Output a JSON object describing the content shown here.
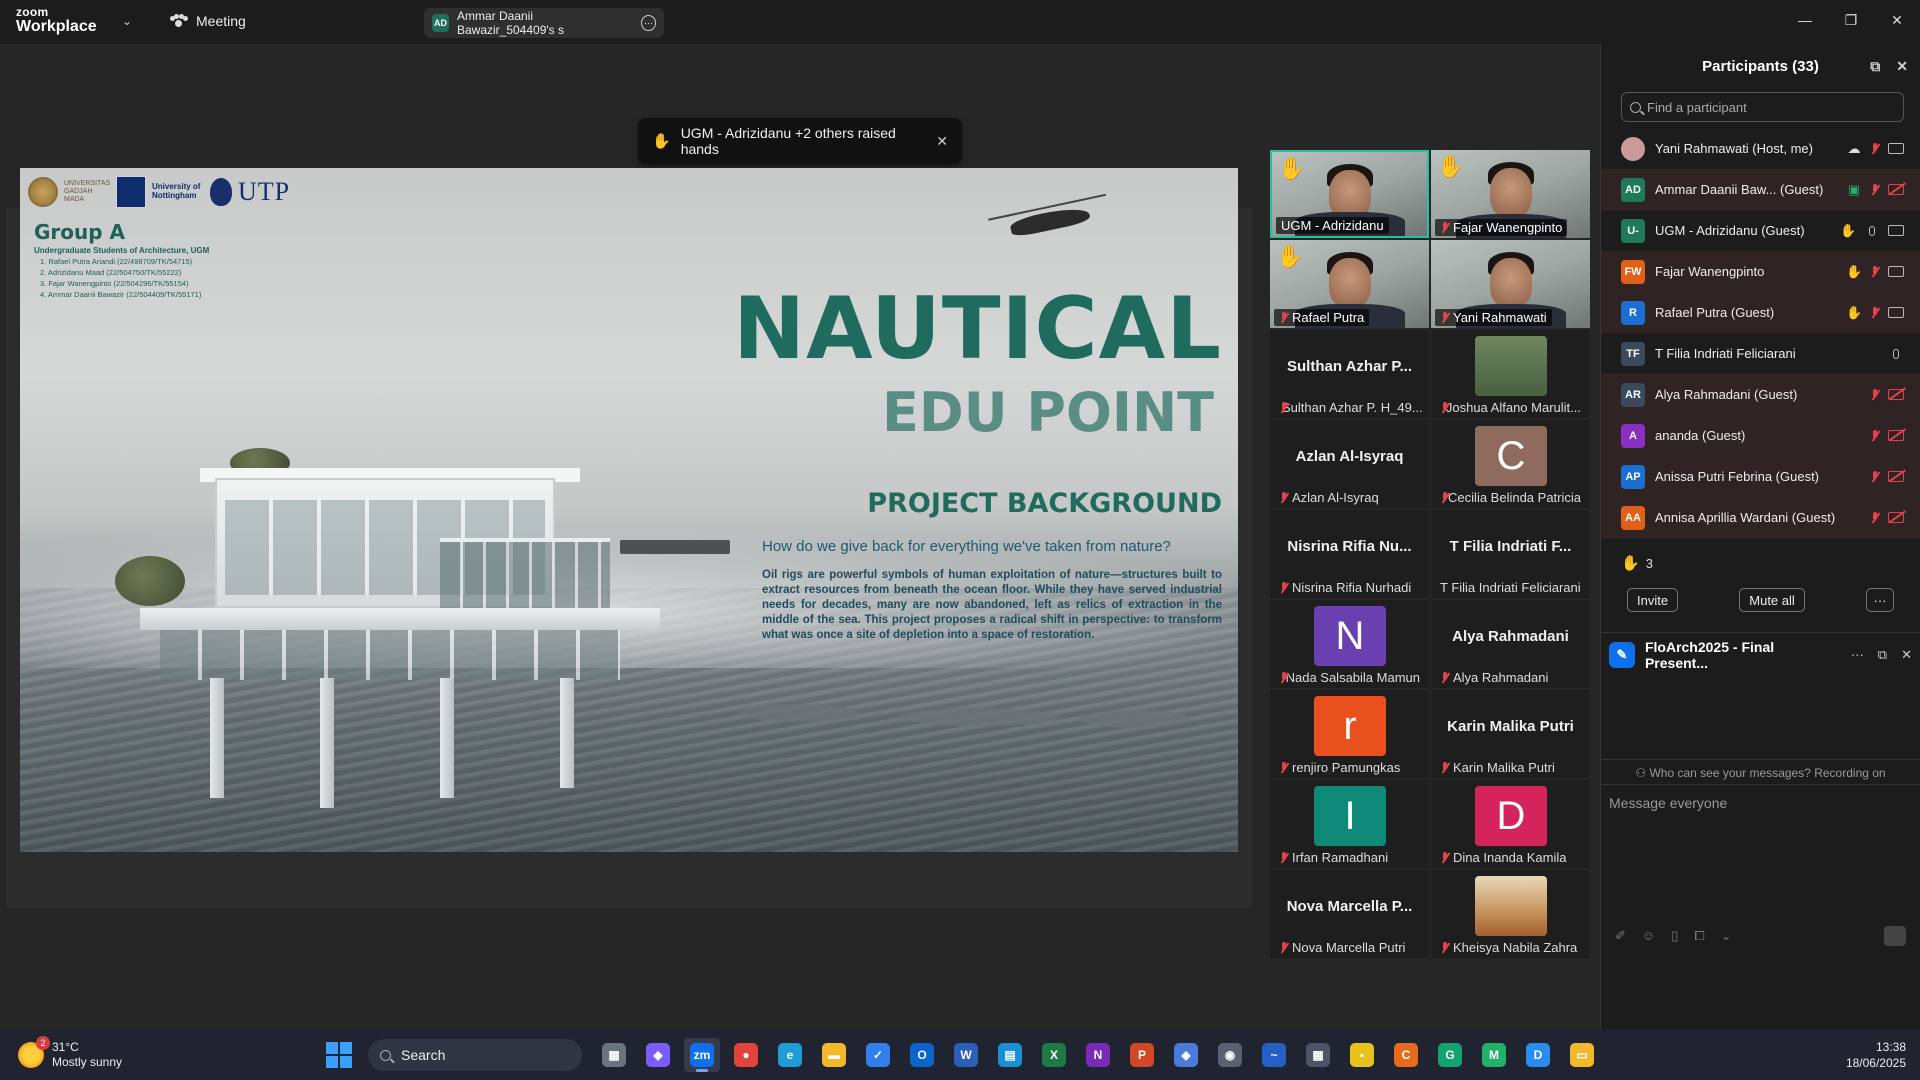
{
  "app": {
    "brand_top": "zoom",
    "brand_bottom": "Workplace",
    "meeting_menu": "Meeting",
    "share_tab": {
      "initials": "AD",
      "label": "Ammar Daanii Bawazir_504409's s"
    }
  },
  "raise_banner": {
    "text": "UGM - Adrizidanu +2 others raised hands"
  },
  "slide": {
    "logos": {
      "ugm": "UNIVERSITAS GADJAH MADA",
      "nottingham": "University of Nottingham",
      "utp": "UTP"
    },
    "group_title": "Group A",
    "group_sub": "Undergraduate Students of Architecture, UGM",
    "members": [
      "1. Rafael Putra Ariandi (22/498709/TK/54715)",
      "2. Adrizidanu Maad (22/504750/TK/55222)",
      "3. Fajar Wanengpinto (22/504296/TK/55154)",
      "4. Ammar Daanii Bawazir (22/504409/TK/55171)"
    ],
    "title": "NAUTICAL",
    "subtitle": "EDU POINT",
    "section": "PROJECT BACKGROUND",
    "question": "How do we give back for everything we've taken from nature?",
    "body": "Oil rigs are powerful symbols of human exploitation of nature—structures built to extract resources from beneath the ocean floor. While they have served industrial needs for decades, many are now abandoned, left as relics of extraction in the middle of the sea. This project proposes a radical shift in perspective: to transform what was once a site of depletion into a space of restoration."
  },
  "gallery": {
    "video_tiles": [
      {
        "name": "UGM - Adrizidanu",
        "hand": true,
        "active": true,
        "muted": false
      },
      {
        "name": "Fajar Wanengpinto",
        "hand": true,
        "active": false,
        "muted": true
      },
      {
        "name": "Rafael Putra",
        "hand": true,
        "active": false,
        "muted": true
      },
      {
        "name": "Yani Rahmawati",
        "hand": false,
        "active": false,
        "muted": true
      }
    ],
    "tiles": [
      {
        "big": "Sulthan Azhar P...",
        "name": "Sulthan Azhar P. H_49...",
        "muted": true,
        "kind": "text"
      },
      {
        "big": "",
        "name": "Joshua Alfano Marulit...",
        "muted": true,
        "kind": "photo"
      },
      {
        "big": "Azlan Al-Isyraq",
        "name": "Azlan Al-Isyraq",
        "muted": true,
        "kind": "text"
      },
      {
        "big": "C",
        "name": "Cecilia Belinda Patricia",
        "muted": true,
        "kind": "avatar",
        "color": "#8f6b5e"
      },
      {
        "big": "Nisrina Rifia Nu...",
        "name": "Nisrina Rifia Nurhadi",
        "muted": true,
        "kind": "text"
      },
      {
        "big": "T Filia Indriati F...",
        "name": "T Filia Indriati Feliciarani",
        "muted": false,
        "kind": "text"
      },
      {
        "big": "N",
        "name": "Nada Salsabila Mamun",
        "muted": true,
        "kind": "avatar",
        "color": "#6a3fb0"
      },
      {
        "big": "Alya Rahmadani",
        "name": "Alya Rahmadani",
        "muted": true,
        "kind": "text"
      },
      {
        "big": "r",
        "name": "renjiro Pamungkas",
        "muted": true,
        "kind": "avatar",
        "color": "#e8501e"
      },
      {
        "big": "Karin Malika Putri",
        "name": "Karin Malika Putri",
        "muted": true,
        "kind": "text"
      },
      {
        "big": "I",
        "name": "Irfan Ramadhani",
        "muted": true,
        "kind": "avatar",
        "color": "#0f8a78"
      },
      {
        "big": "D",
        "name": "Dina Inanda Kamila",
        "muted": true,
        "kind": "avatar",
        "color": "#d4245b"
      },
      {
        "big": "Nova Marcella P...",
        "name": "Nova Marcella Putri",
        "muted": true,
        "kind": "text"
      },
      {
        "big": "",
        "name": "Kheisya Nabila Zahra",
        "muted": true,
        "kind": "photo2"
      }
    ]
  },
  "participants": {
    "title": "Participants (33)",
    "search_placeholder": "Find a participant",
    "rows": [
      {
        "initials": "",
        "name": "Yani Rahmawati (Host, me)",
        "color": "#c99",
        "hand": false,
        "mic": "off",
        "video": "on",
        "alt": false,
        "cloud": true
      },
      {
        "initials": "AD",
        "name": "Ammar Daanii Baw... (Guest)",
        "color": "#1f7a5a",
        "hand": false,
        "mic": "off",
        "video": "off",
        "alt": true,
        "share": true
      },
      {
        "initials": "U-",
        "name": "UGM - Adrizidanu (Guest)",
        "color": "#1f7a5a",
        "hand": true,
        "mic": "on",
        "video": "on",
        "alt": false
      },
      {
        "initials": "FW",
        "name": "Fajar Wanengpinto",
        "color": "#e0601a",
        "hand": true,
        "mic": "off",
        "video": "on",
        "alt": true
      },
      {
        "initials": "R",
        "name": "Rafael Putra (Guest)",
        "color": "#1a6fd1",
        "hand": true,
        "mic": "off",
        "video": "on",
        "alt": true
      },
      {
        "initials": "TF",
        "name": "T Filia Indriati Feliciarani",
        "color": "#3a4a5a",
        "hand": false,
        "mic": "on",
        "video": "none",
        "alt": false
      },
      {
        "initials": "AR",
        "name": "Alya Rahmadani (Guest)",
        "color": "#3a4a5a",
        "hand": false,
        "mic": "off",
        "video": "off",
        "alt": true
      },
      {
        "initials": "A",
        "name": "ananda (Guest)",
        "color": "#8a2fbf",
        "hand": false,
        "mic": "off",
        "video": "off",
        "alt": true
      },
      {
        "initials": "AP",
        "name": "Anissa Putri Febrina (Guest)",
        "color": "#1a6fd1",
        "hand": false,
        "mic": "off",
        "video": "off",
        "alt": true
      },
      {
        "initials": "AA",
        "name": "Annisa Aprillia Wardani (Guest)",
        "color": "#e0601a",
        "hand": false,
        "mic": "off",
        "video": "off",
        "alt": true
      }
    ],
    "raised_count": "3",
    "invite_label": "Invite",
    "mute_all_label": "Mute all",
    "more_label": "···"
  },
  "chat": {
    "title": "FloArch2025 - Final Present...",
    "note": "Who can see your messages? Recording on",
    "placeholder": "Message everyone"
  },
  "taskbar": {
    "temp": "31°C",
    "weather": "Mostly sunny",
    "badge": "2",
    "search": "Search",
    "time": "13:38",
    "date": "18/06/2025",
    "apps": [
      {
        "name": "task-view-icon",
        "color": "#6b7280",
        "glyph": "▦"
      },
      {
        "name": "copilot-icon",
        "color": "#7b5cff",
        "glyph": "◆"
      },
      {
        "name": "zoom-icon",
        "color": "#0e71eb",
        "glyph": "zm",
        "active": true
      },
      {
        "name": "chrome-icon",
        "color": "#e0443b",
        "glyph": "●"
      },
      {
        "name": "edge-icon",
        "color": "#1f9bd7",
        "glyph": "e"
      },
      {
        "name": "file-explorer-icon",
        "color": "#f2b82a",
        "glyph": "▬"
      },
      {
        "name": "todo-icon",
        "color": "#2f80ed",
        "glyph": "✓"
      },
      {
        "name": "outlook-icon",
        "color": "#0a64c9",
        "glyph": "O"
      },
      {
        "name": "word-icon",
        "color": "#2b5fb8",
        "glyph": "W"
      },
      {
        "name": "calculator-icon-blue",
        "color": "#1b8fd6",
        "glyph": "▤"
      },
      {
        "name": "excel-icon",
        "color": "#1e7a45",
        "glyph": "X"
      },
      {
        "name": "onenote-icon",
        "color": "#7a2bb5",
        "glyph": "N"
      },
      {
        "name": "powerpoint-icon",
        "color": "#d24726",
        "glyph": "P"
      },
      {
        "name": "m365-icon",
        "color": "#4a7bd8",
        "glyph": "◈"
      },
      {
        "name": "camera-icon",
        "color": "#5a6070",
        "glyph": "◉"
      },
      {
        "name": "whiteboard-icon",
        "color": "#2561c4",
        "glyph": "~"
      },
      {
        "name": "calculator-icon",
        "color": "#4b5565",
        "glyph": "▦"
      },
      {
        "name": "sticky-notes-icon",
        "color": "#e8c21c",
        "glyph": "▪"
      },
      {
        "name": "orange-app-icon",
        "color": "#e86a1c",
        "glyph": "C"
      },
      {
        "name": "grammarly-icon",
        "color": "#14a36e",
        "glyph": "G"
      },
      {
        "name": "green-app-icon",
        "color": "#20b26b",
        "glyph": "M"
      },
      {
        "name": "blue-app-icon",
        "color": "#2a8cf0",
        "glyph": "D"
      },
      {
        "name": "yellow-app-icon",
        "color": "#f2b82a",
        "glyph": "▭"
      }
    ]
  }
}
